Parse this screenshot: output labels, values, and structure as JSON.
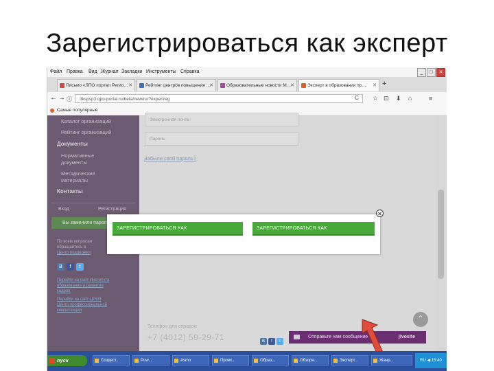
{
  "slide": {
    "title": "Зарегистрироваться как эксперт"
  },
  "browser": {
    "menu": [
      "Файл",
      "Правка",
      "Вид",
      "Журнал",
      "Закладки",
      "Инструменты",
      "Справка"
    ],
    "window_controls": [
      "_",
      "□",
      "✕"
    ],
    "tabs": [
      {
        "label": "Письмо «ЛПО портал Регио…",
        "close": "✕",
        "color": "#d14b3c"
      },
      {
        "label": "Рейтинг центров повышения …",
        "close": "✕",
        "color": "#3d6fc2"
      },
      {
        "label": "Образовательные новости М…",
        "close": "✕",
        "color": "#a34b9a"
      },
      {
        "label": "Эксперт в образовании пр…",
        "close": "✕",
        "color": "#e06020"
      }
    ],
    "new_tab": "+",
    "nav": {
      "back": "←",
      "forward": "→",
      "info": "ⓘ",
      "reload": "C"
    },
    "url": "3kspsp3.qpo-portal.ru/beta/new/ru/?expertreg",
    "tools": [
      "☆",
      "⊡",
      "⬇",
      "⌂",
      "≡"
    ],
    "bookmarks_label": "Самые популярные"
  },
  "sidebar": {
    "items": [
      "Каталог организаций",
      "Рейтинг организаций",
      "Документы",
      "Нормативные",
      "документы",
      "Методические",
      "материалы",
      "Контакты"
    ],
    "login": "Вход",
    "register": "Регистрация",
    "green_button": "Вы заменили пароль",
    "info_lines": [
      "По всем вопросам",
      "обращайтесь в",
      "Центр поддержки"
    ],
    "social": [
      "B",
      "f",
      "t"
    ],
    "links": [
      "Перейти на сайт Института",
      "образования и развития",
      "кадров",
      "Перейти на сайт ЦРКО",
      "Центр профессиональной",
      "компетенций"
    ]
  },
  "content": {
    "field1_placeholder": "Электронная почта",
    "field2_placeholder": "Пароль",
    "forgot_link": "Забыли свой пароль?"
  },
  "modal": {
    "close_icon": "✕",
    "button_left": "ЗАРЕГИСТРИРОВАТЬСЯ КАК",
    "button_right": "ЗАРЕГИСТРИРОВАТЬСЯ КАК"
  },
  "footer": {
    "phone_label": "Телефон для справок:",
    "phone": "+7 (4012) 59-29-71",
    "social": [
      "B",
      "f",
      "t"
    ],
    "scroll_top": "⌃",
    "jivo_message": "Отправьте нам сообщение",
    "jivo_brand": "jivosite"
  },
  "taskbar": {
    "start": "пуск",
    "tasks": [
      "Создест...",
      "Pow...",
      "Asmo",
      "Проек...",
      "Образ...",
      "Обзорн...",
      "Эксперт...",
      "Жанр..."
    ],
    "clock": "RU ◀ 15:40"
  },
  "colors": {
    "sidebar": "#6c5a70",
    "register_button": "#48a83a",
    "taskbar": "#2a4f9c",
    "arrow": "#e24c3a"
  }
}
